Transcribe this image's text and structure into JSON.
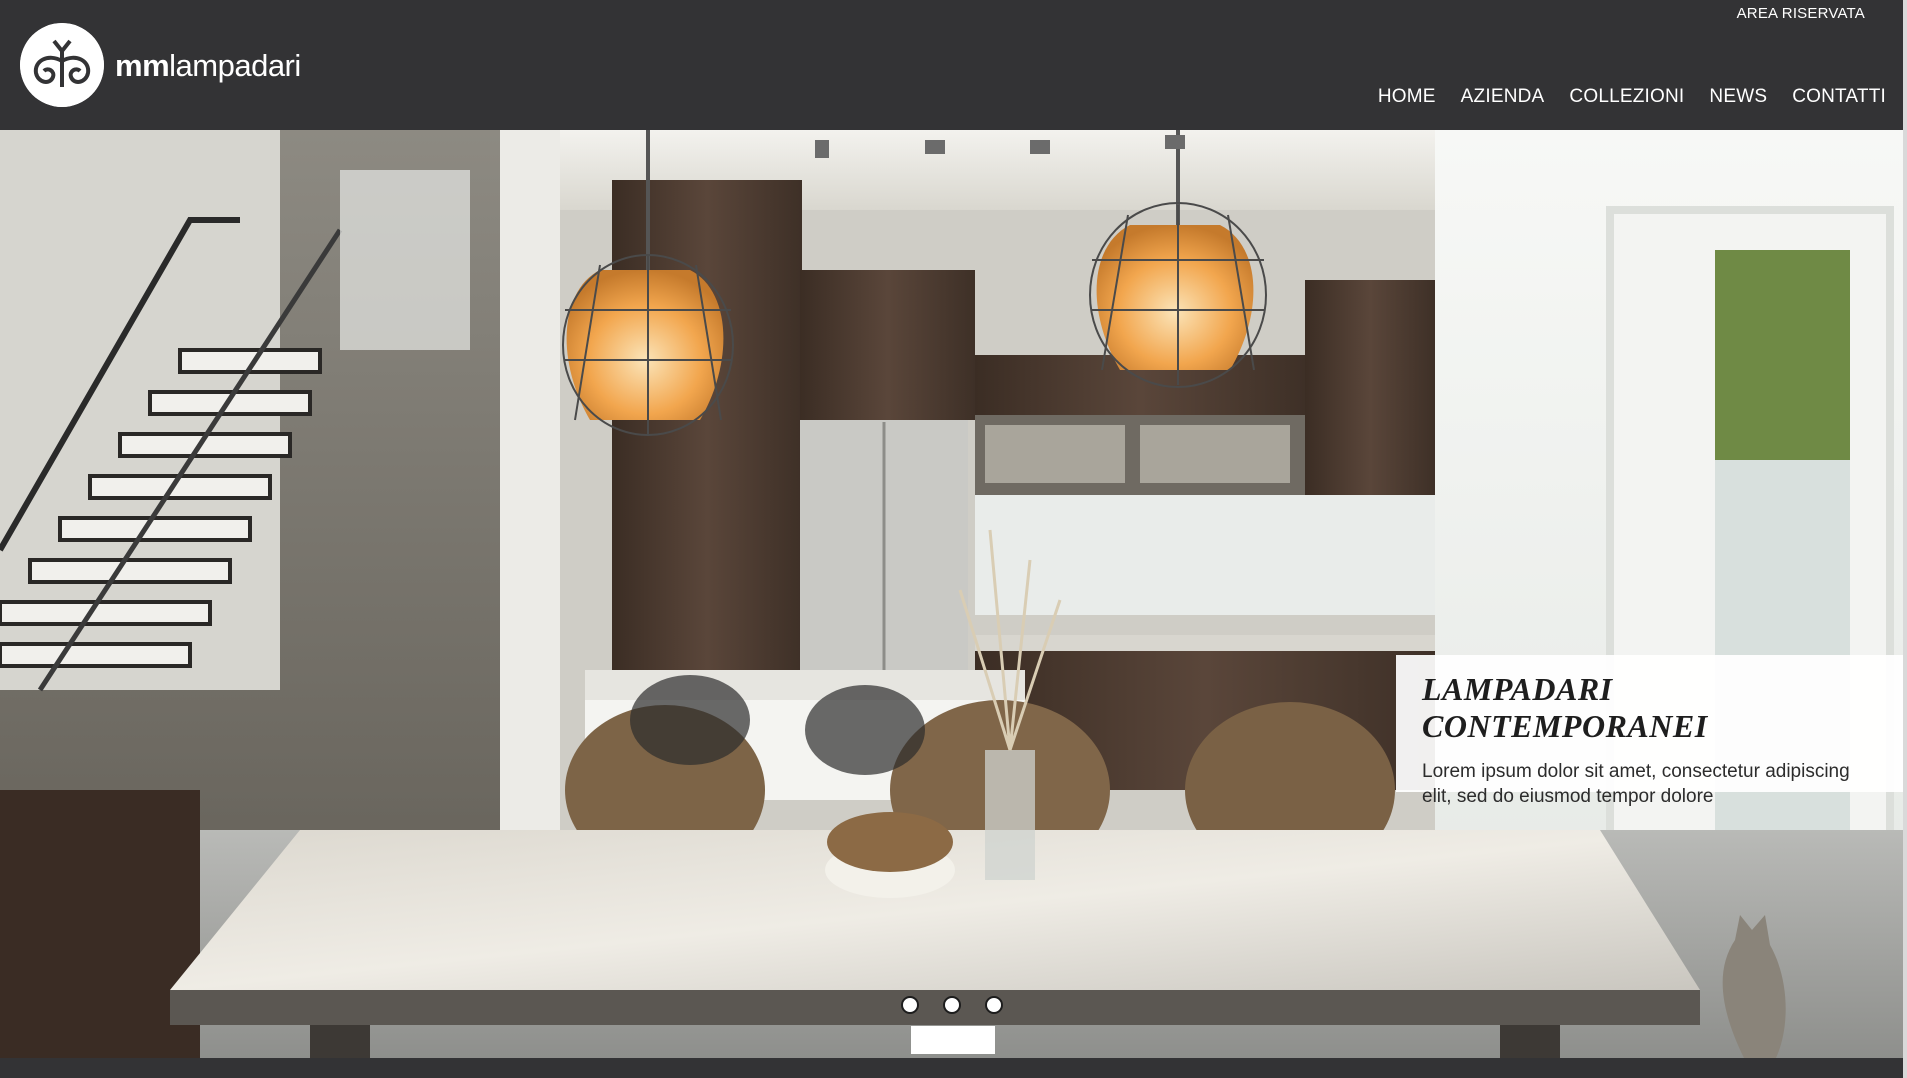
{
  "header": {
    "area_riservata": "AREA RISERVATA",
    "logo_bold": "mm",
    "logo_light": "lampadari",
    "nav": [
      "HOME",
      "AZIENDA",
      "COLLEZIONI",
      "NEWS",
      "CONTATTI"
    ]
  },
  "hero": {
    "caption_title": "LAMPADARI CONTEMPORANEI",
    "caption_text_line1": "Lorem ipsum dolor sit amet, consectetur adipiscing",
    "caption_text_line2": "elit, sed do eiusmod tempor dolore",
    "slides": 3
  },
  "colors": {
    "header_bg": "#333335",
    "nav_text": "#ffffff",
    "caption_bg": "#ffffff",
    "lamp_glow": "#f2a64e",
    "wood": "#4a3a30"
  }
}
